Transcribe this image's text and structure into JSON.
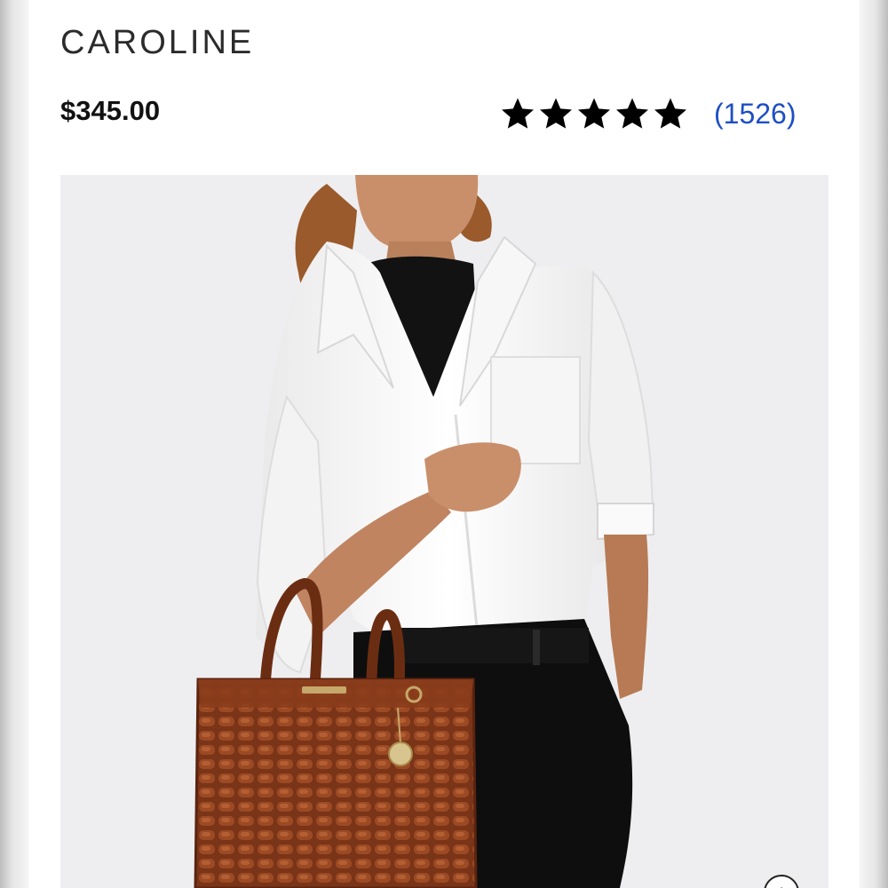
{
  "product": {
    "title": "CAROLINE",
    "price": "$345.00",
    "rating": {
      "stars": 5,
      "review_count_label": "(1526)",
      "star_color": "#000000",
      "link_color": "#1d4fc4"
    },
    "image": {
      "alt": "Model in white button-down shirt and black trousers holding a brown croc-embossed leather tote bag",
      "background": "#eeeef0"
    },
    "zoom_icon": "plus-icon"
  }
}
